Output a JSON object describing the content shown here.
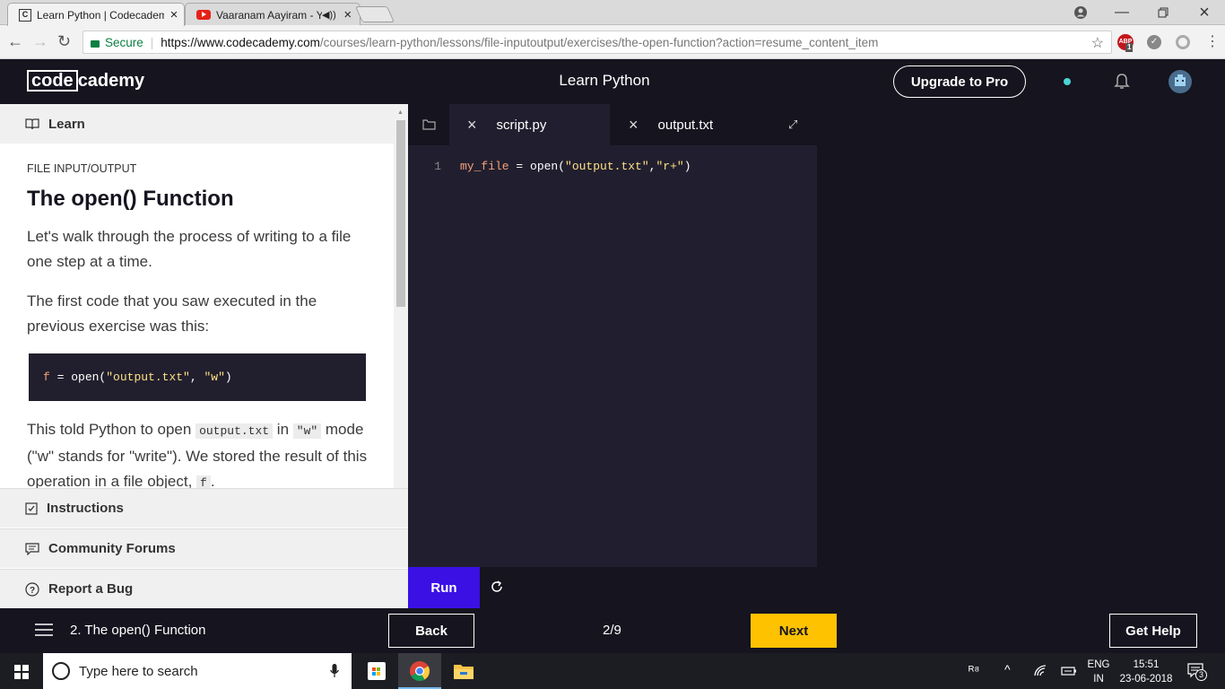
{
  "browser": {
    "tabs": [
      {
        "title": "Learn Python | Codecademy",
        "active": true
      },
      {
        "title": "Vaaranam Aayiram - YouTube",
        "active": false
      }
    ],
    "secure_label": "Secure",
    "url_host": "https://www.codecademy.com",
    "url_path": "/courses/learn-python/lessons/file-inputoutput/exercises/the-open-function?action=resume_content_item",
    "extension_badge": "1"
  },
  "header": {
    "logo_code": "code",
    "logo_rest": "cademy",
    "course_title": "Learn Python",
    "upgrade_label": "Upgrade to Pro"
  },
  "left": {
    "learn_label": "Learn",
    "lesson_label": "FILE INPUT/OUTPUT",
    "title": "The open() Function",
    "para1": "Let's walk through the process of writing to a file one step at a time.",
    "para2": "The first code that you saw executed in the previous exercise was this:",
    "code_var": "f",
    "code_eq": " = open(",
    "code_arg1": "\"output.txt\"",
    "code_comma": ", ",
    "code_arg2": "\"w\"",
    "code_close": ")",
    "para3_a": "This told Python to open ",
    "para3_code1": "output.txt",
    "para3_b": " in ",
    "para3_code2": "\"w\"",
    "para3_c": " mode (\"w\" stands for \"write\"). We stored the result of this operation in a file object, ",
    "para3_code3": "f",
    "para3_d": ".",
    "instructions_label": "Instructions",
    "forums_label": "Community Forums",
    "bug_label": "Report a Bug"
  },
  "editor": {
    "tab1": "script.py",
    "tab2": "output.txt",
    "line_number": "1",
    "line_var": "my_file",
    "line_eq": " = open(",
    "line_arg1": "\"output.txt\"",
    "line_comma": ",",
    "line_arg2": "\"r+\"",
    "line_close": ")",
    "run_label": "Run"
  },
  "footer": {
    "exercise_title": "2. The open() Function",
    "back_label": "Back",
    "progress": "2/9",
    "next_label": "Next",
    "help_label": "Get Help"
  },
  "taskbar": {
    "search_placeholder": "Type here to search",
    "lang_top": "ENG",
    "lang_bottom": "IN",
    "time": "15:51",
    "date": "23-06-2018",
    "notif_count": "3"
  },
  "colors": {
    "accent_purple": "#3a10e5",
    "next_yellow": "#ffc200",
    "code_orange": "#f5a27a",
    "code_string": "#ffe083",
    "status_dot": "#4ad4d4"
  }
}
